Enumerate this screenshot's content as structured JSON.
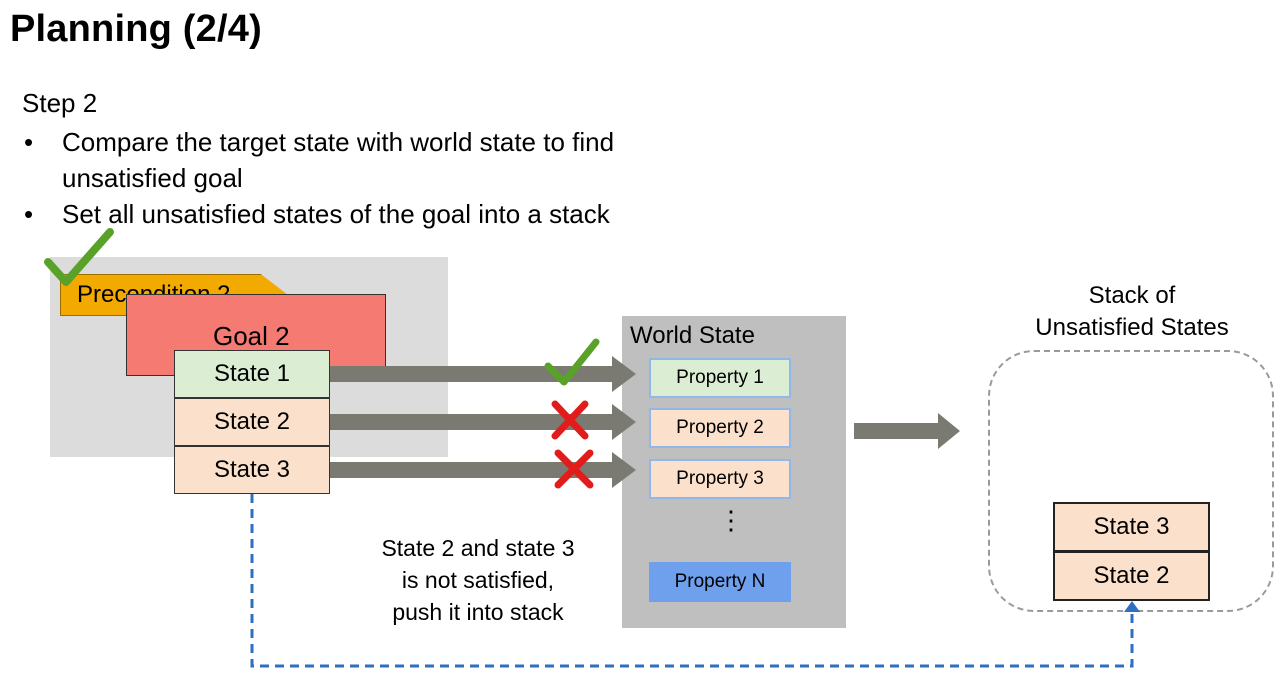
{
  "slide": {
    "title": "Planning (2/4)",
    "step": "Step 2",
    "bullets": [
      "Compare the target state with world state to find unsatisfied goal",
      "Set all unsatisfied states of the goal into a stack"
    ]
  },
  "goal_panel": {
    "precondition": "Precondition 2",
    "goal": "Goal 2",
    "states": [
      "State 1",
      "State 2",
      "State 3"
    ]
  },
  "world_state": {
    "title": "World State",
    "properties": [
      "Property 1",
      "Property 2",
      "Property 3",
      "Property N"
    ],
    "ellipsis": "⋮"
  },
  "caption": [
    "State 2 and state 3",
    "is not satisfied,",
    "push it into stack"
  ],
  "stack": {
    "title_line1": "Stack of",
    "title_line2": "Unsatisfied States",
    "items": [
      "State 3",
      "State 2"
    ]
  },
  "colors": {
    "check": "#5aa12a",
    "cross": "#e21b1b",
    "arrow": "#7a7a72",
    "dashed_link": "#2f6fbf",
    "precondition": "#f2a900",
    "goal": "#f47a72",
    "satisfied": "#dbeed3",
    "unsatisfied": "#fbe1cb"
  }
}
